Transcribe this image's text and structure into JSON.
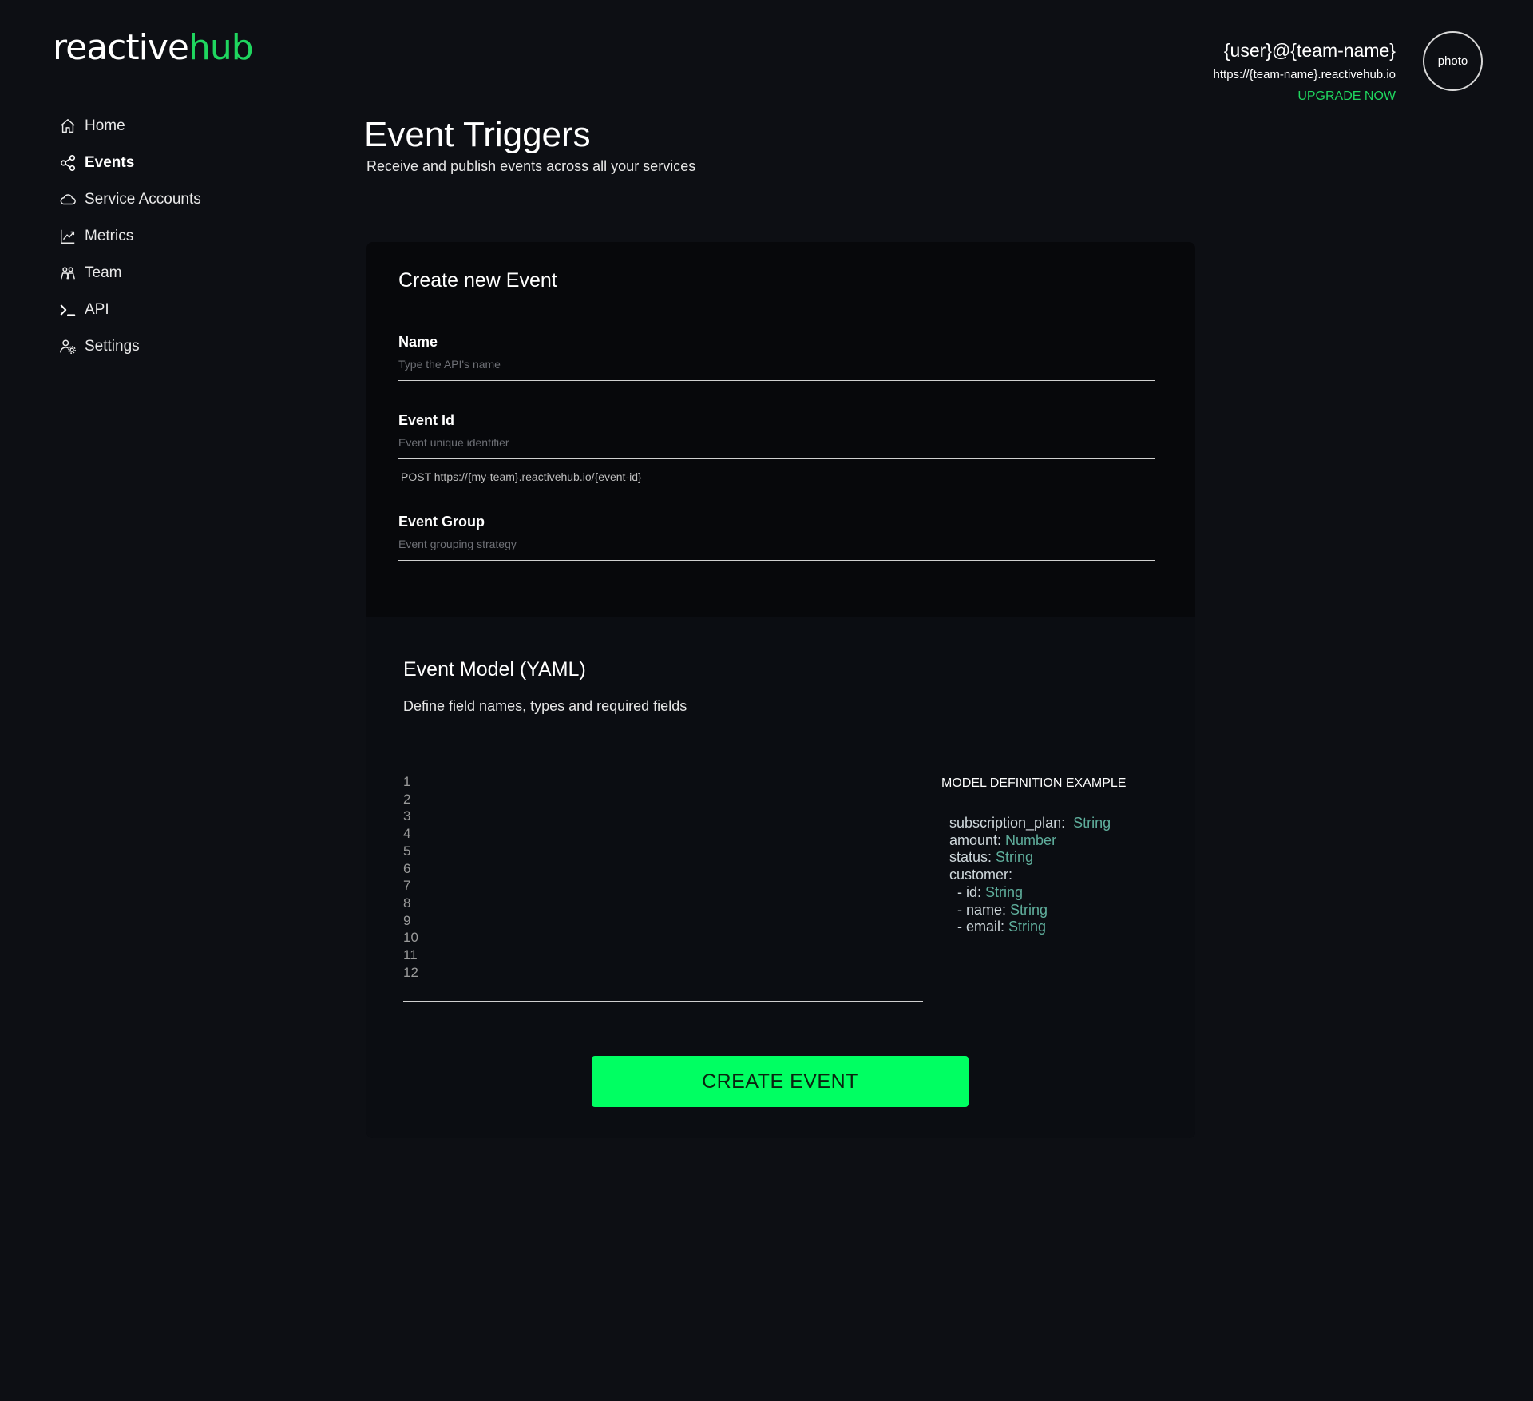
{
  "brand": {
    "part1": "reactive",
    "part2": "hub"
  },
  "user": {
    "name": "{user}@{team-name}",
    "url": "https://{team-name}.reactivehub.io",
    "upgrade": "UPGRADE NOW",
    "avatar": "photo"
  },
  "sidebar": {
    "items": [
      {
        "label": "Home",
        "icon": "home-icon"
      },
      {
        "label": "Events",
        "icon": "share-icon",
        "active": true
      },
      {
        "label": "Service Accounts",
        "icon": "cloud-icon"
      },
      {
        "label": "Metrics",
        "icon": "chart-icon"
      },
      {
        "label": "Team",
        "icon": "team-icon"
      },
      {
        "label": "API",
        "icon": "terminal-icon"
      },
      {
        "label": "Settings",
        "icon": "user-settings-icon"
      }
    ]
  },
  "page": {
    "title": "Event Triggers",
    "subtitle": "Receive and publish events across all your services"
  },
  "form": {
    "title": "Create new Event",
    "name": {
      "label": "Name",
      "placeholder": "Type the API's name",
      "value": ""
    },
    "event_id": {
      "label": "Event Id",
      "placeholder": "Event unique identifier",
      "value": "",
      "hint": "POST https://{my-team}.reactivehub.io/{event-id}"
    },
    "event_group": {
      "label": "Event Group",
      "placeholder": "Event grouping strategy",
      "value": ""
    }
  },
  "model": {
    "title": "Event Model (YAML)",
    "subtitle": "Define field names, types and required fields",
    "line_numbers": [
      "1",
      "2",
      "3",
      "4",
      "5",
      "6",
      "7",
      "8",
      "9",
      "10",
      "11",
      "12"
    ],
    "example_title": "MODEL DEFINITION EXAMPLE",
    "example_lines": [
      {
        "key": "subscription_plan:  ",
        "type": "String"
      },
      {
        "key": "amount: ",
        "type": "Number"
      },
      {
        "key": "status: ",
        "type": "String"
      },
      {
        "key": "customer:",
        "type": ""
      },
      {
        "key": "  - id: ",
        "type": "String"
      },
      {
        "key": "  - name: ",
        "type": "String"
      },
      {
        "key": "  - email: ",
        "type": "String"
      }
    ]
  },
  "actions": {
    "create": "CREATE EVENT"
  },
  "colors": {
    "accent": "#1fd65f",
    "button": "#00ff62",
    "background": "#0d0f14",
    "card": "#07080b",
    "type_color": "#5fae9c"
  }
}
